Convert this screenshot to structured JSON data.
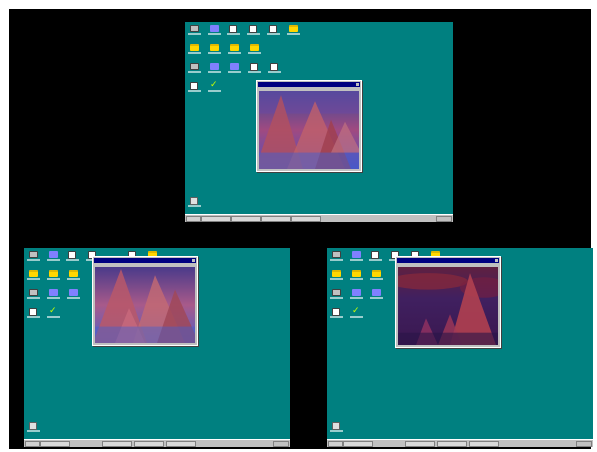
{
  "screenshots": [
    {
      "id": "top",
      "window_title": "",
      "scene": "pinkhaze",
      "taskbar_tasks": 4
    },
    {
      "id": "bottom-left",
      "window_title": "",
      "scene": "pinkhaze",
      "taskbar_tasks": 4
    },
    {
      "id": "bottom-right",
      "window_title": "",
      "scene": "darkred",
      "taskbar_tasks": 4
    }
  ],
  "icons": {
    "top_row": [
      "computer-icon",
      "network-icon",
      "doc-icon",
      "doc-icon",
      "pen-icon",
      "folder-icon"
    ],
    "folder_row": [
      "folder-icon",
      "folder-icon",
      "folder-icon",
      "folder-icon"
    ],
    "app_row": [
      "computer-icon",
      "network-icon",
      "network-icon",
      "doc-icon",
      "doc-icon"
    ],
    "misc_row": [
      "doc-icon",
      "check-icon"
    ],
    "bottom": [
      "recycle-bin-icon"
    ]
  },
  "colors": {
    "desktop": "#008080",
    "frame": "#000000",
    "title_bar": "#000080",
    "window_face": "#c0c0c0"
  }
}
